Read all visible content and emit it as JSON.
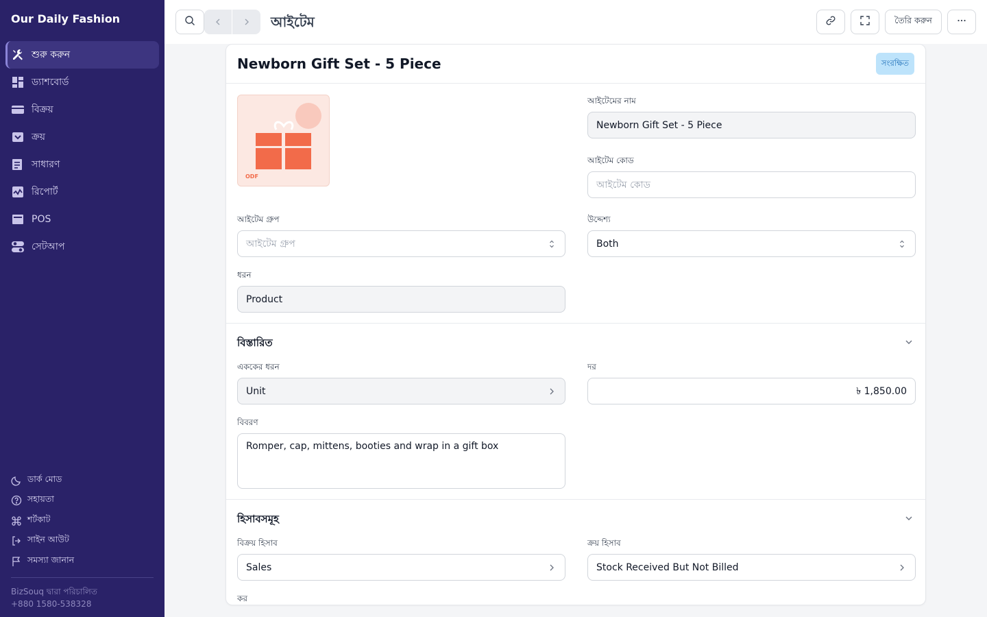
{
  "sidebar": {
    "brand": "Our Daily Fashion",
    "items": [
      {
        "label": "শুরু করুন",
        "icon": "tools-icon"
      },
      {
        "label": "ড্যাশবোর্ড",
        "icon": "dashboard-icon"
      },
      {
        "label": "বিক্রয়",
        "icon": "card-icon"
      },
      {
        "label": "ক্রয়",
        "icon": "inbox-icon"
      },
      {
        "label": "সাধারণ",
        "icon": "ledger-icon"
      },
      {
        "label": "রিপোর্ট",
        "icon": "report-icon"
      },
      {
        "label": "POS",
        "icon": "pos-icon"
      },
      {
        "label": "সেটআপ",
        "icon": "toggle-icon"
      }
    ],
    "bottom_links": [
      {
        "label": "ডার্ক মোড",
        "icon": "moon-icon"
      },
      {
        "label": "সহায়তা",
        "icon": "help-icon"
      },
      {
        "label": "শর্টকাট",
        "icon": "command-icon"
      },
      {
        "label": "সাইন আউট",
        "icon": "sign-out-icon"
      },
      {
        "label": "সমস্যা জানান",
        "icon": "flag-icon"
      }
    ],
    "footer_line1": "BizSouq দ্বারা পরিচালিত",
    "footer_line2": "+880 1580-538328"
  },
  "topbar": {
    "title": "আইটেম",
    "create_label": "তৈরি করুন"
  },
  "form": {
    "title": "Newborn Gift Set - 5 Piece",
    "status": "সংরক্ষিত",
    "image_text": "ODF",
    "item_name_label": "আইটেমের নাম",
    "item_name_value": "Newborn Gift Set - 5 Piece",
    "item_code_label": "আইটেম কোড",
    "item_code_placeholder": "আইটেম কোড",
    "item_group_label": "আইটেম গ্রুপ",
    "item_group_placeholder": "আইটেম গ্রুপ",
    "purpose_label": "উদ্দেশ্য",
    "purpose_value": "Both",
    "type_label": "ধরন",
    "type_value": "Product",
    "details_section": "বিস্তারিত",
    "unit_type_label": "এককের ধরন",
    "unit_type_value": "Unit",
    "rate_label": "দর",
    "rate_value": "৳ 1,850.00",
    "description_label": "বিবরণ",
    "description_value": "Romper, cap, mittens, booties and wrap in a gift box",
    "accounts_section": "হিসাবসমূহ",
    "sales_account_label": "বিক্রয় হিসাব",
    "sales_account_value": "Sales",
    "purchase_account_label": "ক্রয় হিসাব",
    "purchase_account_value": "Stock Received But Not Billed",
    "tax_label": "কর"
  },
  "colors": {
    "sidebar_bg": "#2a2268",
    "badge_bg": "#bde3fb",
    "badge_text": "#1d6fb8",
    "gift_accent": "#f26b4a"
  }
}
